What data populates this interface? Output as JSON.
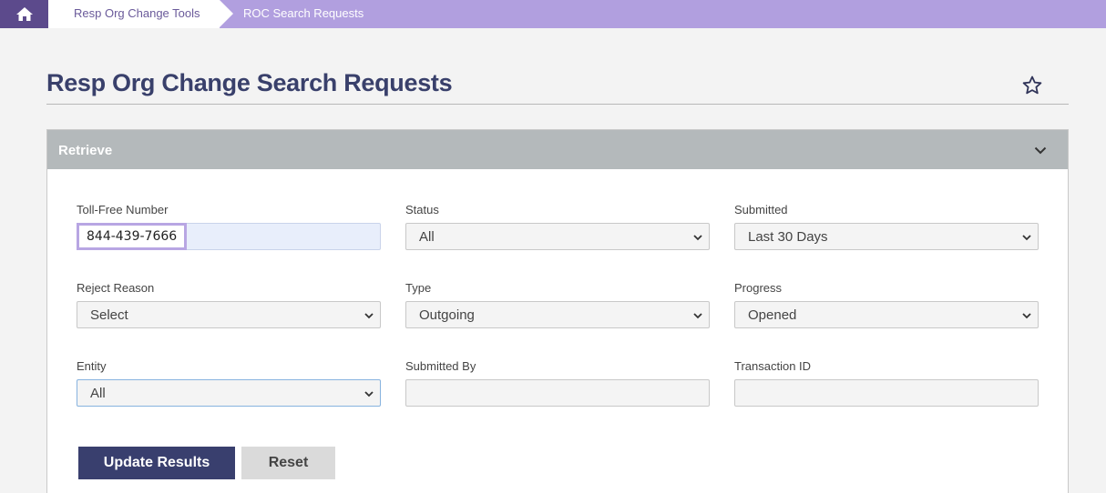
{
  "breadcrumb": {
    "home_icon": "home-icon",
    "items": [
      "Resp Org Change Tools",
      "ROC Search Requests"
    ]
  },
  "page": {
    "title": "Resp Org Change Search Requests",
    "favorite_icon": "star-outline-icon"
  },
  "panel": {
    "title": "Retrieve",
    "toggle_icon": "chevron-down-icon",
    "fields": {
      "toll_free_number": {
        "label": "Toll-Free Number",
        "value": "844-439-7666"
      },
      "status": {
        "label": "Status",
        "value": "All"
      },
      "submitted": {
        "label": "Submitted",
        "value": "Last 30 Days"
      },
      "reject_reason": {
        "label": "Reject Reason",
        "value": "Select"
      },
      "type": {
        "label": "Type",
        "value": "Outgoing"
      },
      "progress": {
        "label": "Progress",
        "value": "Opened"
      },
      "entity": {
        "label": "Entity",
        "value": "All"
      },
      "submitted_by": {
        "label": "Submitted By",
        "value": ""
      },
      "transaction_id": {
        "label": "Transaction ID",
        "value": ""
      }
    },
    "buttons": {
      "update": "Update Results",
      "reset": "Reset"
    }
  },
  "colors": {
    "breadcrumb_bg": "#b19fdf",
    "home_bg": "#5c4a8c",
    "title": "#39406b",
    "panel_header": "#b4b9bb",
    "primary_button": "#393f6e"
  }
}
